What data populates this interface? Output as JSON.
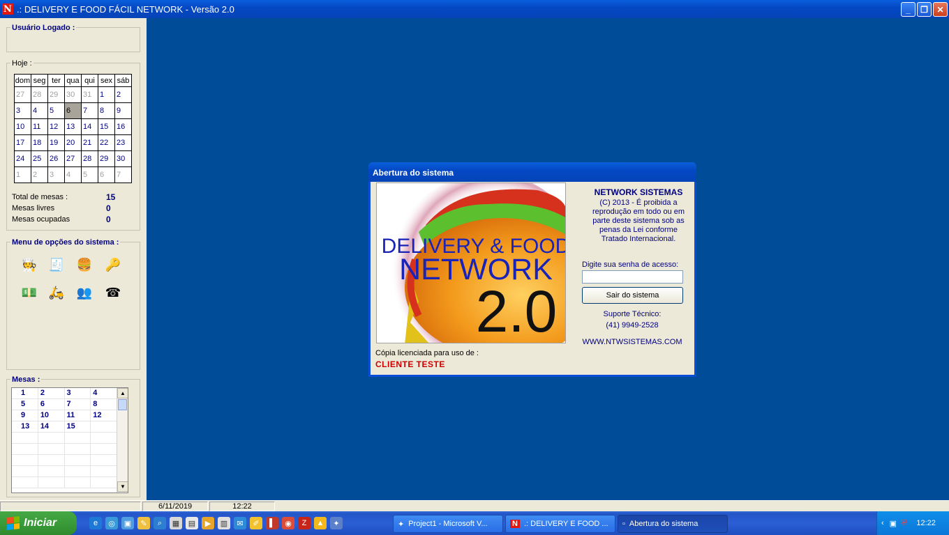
{
  "window": {
    "title": ".: DELIVERY E FOOD FÁCIL NETWORK - Versão 2.0",
    "logo_letter": "N",
    "minimize": "_",
    "restore": "❐",
    "close": "✕"
  },
  "sidebar": {
    "user_group": {
      "title": "Usuário Logado :"
    },
    "today_group": {
      "title": "Hoje :",
      "weekdays": [
        "dom",
        "seg",
        "ter",
        "qua",
        "qui",
        "sex",
        "sáb"
      ],
      "weeks": [
        [
          "27",
          "28",
          "29",
          "30",
          "31",
          "1",
          "2"
        ],
        [
          "3",
          "4",
          "5",
          "6",
          "7",
          "8",
          "9"
        ],
        [
          "10",
          "11",
          "12",
          "13",
          "14",
          "15",
          "16"
        ],
        [
          "17",
          "18",
          "19",
          "20",
          "21",
          "22",
          "23"
        ],
        [
          "24",
          "25",
          "26",
          "27",
          "28",
          "29",
          "30"
        ],
        [
          "1",
          "2",
          "3",
          "4",
          "5",
          "6",
          "7"
        ]
      ],
      "total_label": "Total de mesas :",
      "total_value": "15",
      "free_label": "Mesas livres",
      "free_value": "0",
      "busy_label": "Mesas ocupadas",
      "busy_value": "0"
    },
    "menu_group": {
      "title": "Menu de opções do sistema :"
    },
    "mesas_group": {
      "title": "Mesas :",
      "rows": [
        [
          "1",
          "2",
          "3",
          "4"
        ],
        [
          "5",
          "6",
          "7",
          "8"
        ],
        [
          "9",
          "10",
          "11",
          "12"
        ],
        [
          "13",
          "14",
          "15",
          ""
        ],
        [
          "",
          "",
          "",
          ""
        ],
        [
          "",
          "",
          "",
          ""
        ],
        [
          "",
          "",
          "",
          ""
        ],
        [
          "",
          "",
          "",
          ""
        ],
        [
          "",
          "",
          "",
          ""
        ]
      ]
    }
  },
  "statusbar": {
    "date": "6/11/2019",
    "time": "12:22"
  },
  "dialog": {
    "title": "Abertura do sistema",
    "splash_line1": "DELIVERY & FOOD",
    "splash_line2": "NETWORK",
    "splash_line3": "2.0",
    "company": "NETWORK SISTEMAS",
    "copyright": "(C) 2013 - É proibida a reprodução em todo ou em parte deste sistema sob as penas da Lei conforme Tratado Internacional.",
    "password_label": "Digite sua senha de acesso:",
    "password_value": "",
    "exit_button": "Sair do sistema",
    "support_label": "Suporte Técnico:",
    "support_phone": "(41) 9949-2528",
    "website": "WWW.NTWSISTEMAS.COM",
    "license_label": "Cópia licenciada para uso de :",
    "license_name": "CLIENTE TESTE"
  },
  "taskbar": {
    "start_label": "Iniciar",
    "buttons": [
      {
        "label": "Project1 - Microsoft V..."
      },
      {
        "label": ".: DELIVERY E FOOD ..."
      },
      {
        "label": "Abertura do sistema"
      }
    ],
    "clock": "12:22"
  }
}
